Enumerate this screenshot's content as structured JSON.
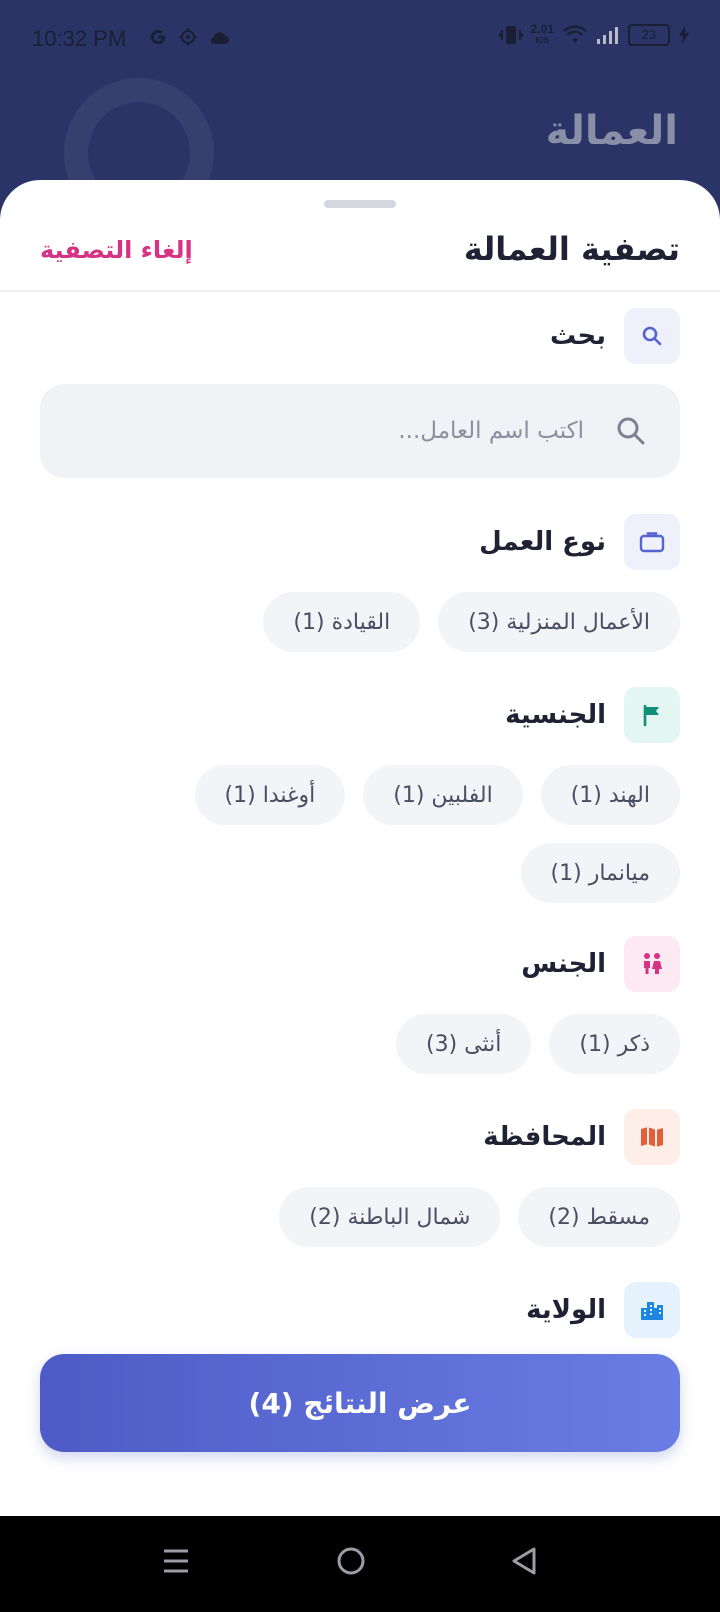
{
  "status_bar": {
    "time": "10:32 PM",
    "net_speed": "2.01",
    "net_unit": "K/S",
    "battery": "23"
  },
  "background": {
    "title": "العمالة"
  },
  "sheet": {
    "title": "تصفية العمالة",
    "clear_label": "إلغاء التصفية"
  },
  "search": {
    "label": "بحث",
    "placeholder": "اكتب اسم العامل..."
  },
  "sections": {
    "work_type": {
      "label": "نوع العمل",
      "chips": [
        "الأعمال المنزلية (3)",
        "القيادة (1)"
      ]
    },
    "nationality": {
      "label": "الجنسية",
      "chips": [
        "الهند (1)",
        "الفلبين (1)",
        "أوغندا (1)",
        "ميانمار (1)"
      ]
    },
    "gender": {
      "label": "الجنس",
      "chips": [
        "ذكر (1)",
        "أنثى (3)"
      ]
    },
    "governorate": {
      "label": "المحافظة",
      "chips": [
        "مسقط (2)",
        "شمال الباطنة (2)"
      ]
    },
    "wilayat": {
      "label": "الولاية"
    }
  },
  "results_button": "عرض النتائج (4)",
  "icons": {
    "search": "search-icon",
    "work_type": "briefcase-icon",
    "nationality": "flag-icon",
    "gender": "people-icon",
    "governorate": "map-icon",
    "wilayat": "city-icon"
  },
  "colors": {
    "accent": "#5563d0",
    "clear": "#d63384",
    "background_app": "#2b3466"
  }
}
